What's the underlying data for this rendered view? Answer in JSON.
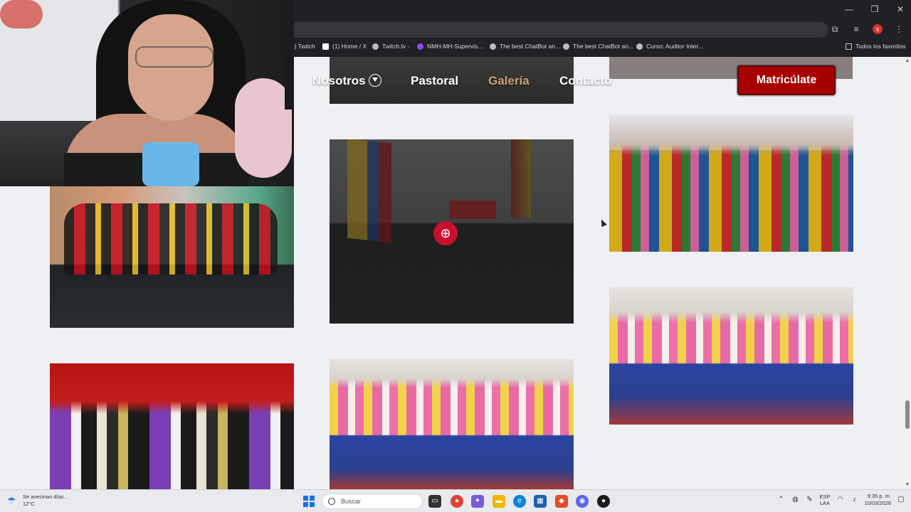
{
  "bookmarks": [
    {
      "label": "(9) Twitch",
      "icon": "twitch-icon"
    },
    {
      "label": "(1) Home / X",
      "icon": "x-icon"
    },
    {
      "label": "Twitch.tv -",
      "icon": "twitch-icon"
    },
    {
      "label": "NMH-MH-Supervis...",
      "icon": "site-icon"
    },
    {
      "label": "The best ChatBot an...",
      "icon": "chatgpt-icon"
    },
    {
      "label": "The best ChatBot an...",
      "icon": "chatgpt-icon"
    },
    {
      "label": "Curso: Auditor Inter...",
      "icon": "site-icon"
    }
  ],
  "bookmarks_folder": "Todos los favoritos",
  "profile_initial": "s",
  "nav": {
    "items": [
      "Nosotros",
      "Pastoral",
      "Galería",
      "Contacto"
    ],
    "active": "Galería",
    "cta": "Matricúlate",
    "accent_color": "#c9a173",
    "cta_color": "#a80000"
  },
  "taskbar": {
    "weather_text": "Se avecinan días...",
    "weather_temp": "12°C",
    "search_placeholder": "Buscar",
    "lang_line1": "ESP",
    "lang_line2": "LAA",
    "time": "9:35 p. m.",
    "date": "10/03/2026"
  }
}
